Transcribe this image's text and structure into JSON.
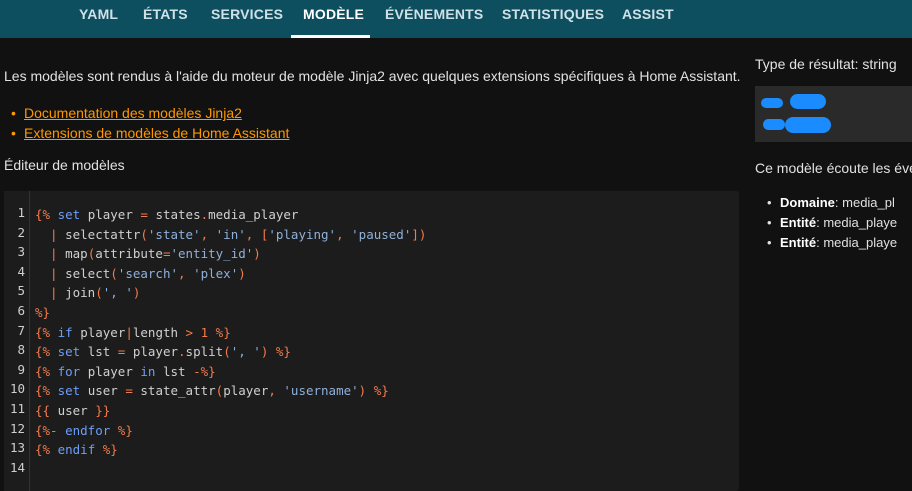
{
  "tabs": [
    {
      "label": "YAML",
      "active": false
    },
    {
      "label": "ÉTATS",
      "active": false
    },
    {
      "label": "SERVICES",
      "active": false
    },
    {
      "label": "MODÈLE",
      "active": true
    },
    {
      "label": "ÉVÉNEMENTS",
      "active": false
    },
    {
      "label": "STATISTIQUES",
      "active": false
    },
    {
      "label": "ASSIST",
      "active": false
    }
  ],
  "intro": "Les modèles sont rendus à l'aide du moteur de modèle Jinja2 avec quelques extensions spécifiques à Home Assistant.",
  "links": [
    "Documentation des modèles Jinja2",
    "Extensions de modèles de Home Assistant"
  ],
  "editor_title": "Éditeur de modèles",
  "code_lines": [
    "{% set player = states.media_player",
    "  | selectattr('state', 'in', ['playing', 'paused'])",
    "  | map(attribute='entity_id')",
    "  | select('search', 'plex')",
    "  | join(', ')",
    "%}",
    "{% if player|length > 1 %}",
    "{% set lst = player.split(', ') %}",
    "{% for player in lst -%}",
    "{% set user = state_attr(player, 'username') %}",
    "{{ user }}",
    "{%- endfor %}",
    "{% endif %}",
    ""
  ],
  "result_type": "Type de résultat: string",
  "listens": "Ce modèle écoute les évé",
  "entities": [
    {
      "key": "Domaine",
      "value": ": media_pl"
    },
    {
      "key": "Entité",
      "value": ": media_playe"
    },
    {
      "key": "Entité",
      "value": ": media_playe"
    }
  ],
  "colors": {
    "header": "#0e4f5f",
    "background": "#111111",
    "editor": "#1c1c1c",
    "link": "#ff9800",
    "redaction": "#1a8cff"
  }
}
